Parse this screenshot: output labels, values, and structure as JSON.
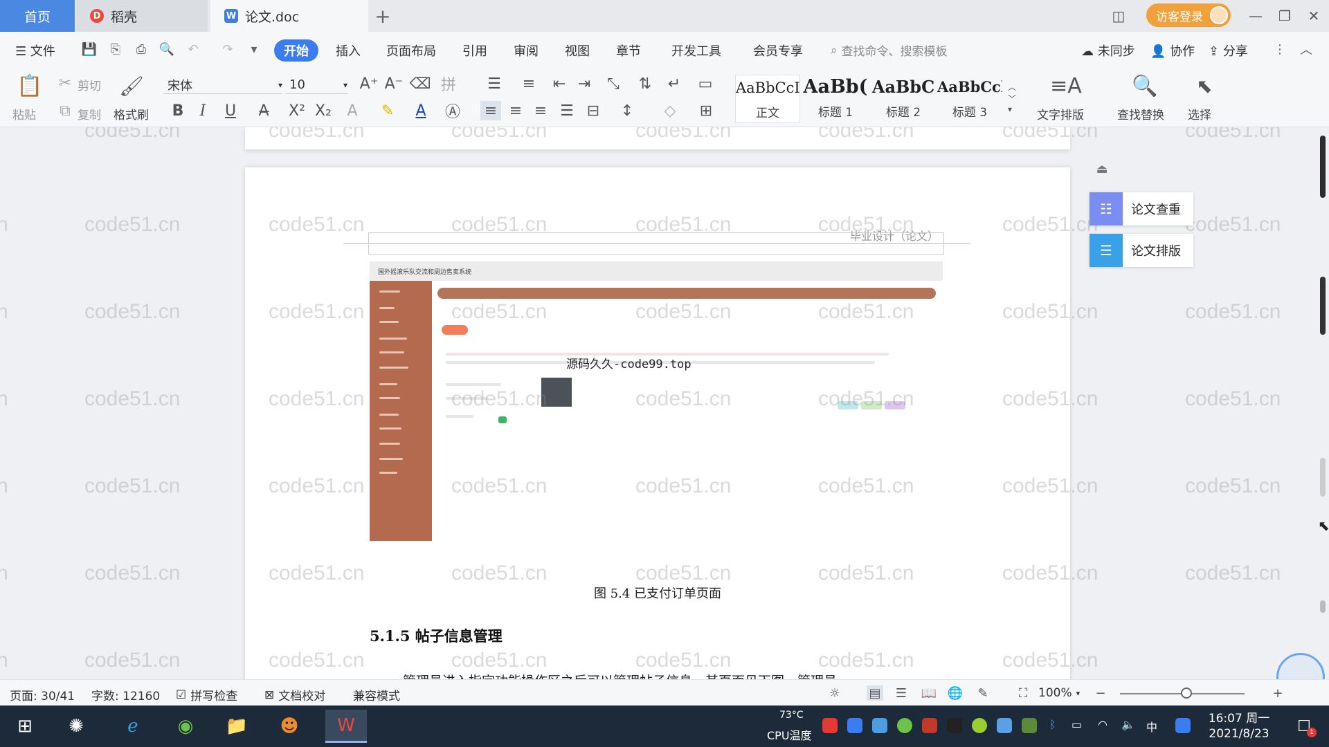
{
  "tabs": {
    "home": "首页",
    "docer": "稻壳",
    "doc": "论文.doc",
    "add": "+",
    "docer_logo": "D",
    "doc_logo": "W"
  },
  "login": {
    "label": "访客登录"
  },
  "menu": {
    "file": "文件",
    "items": [
      "开始",
      "插入",
      "页面布局",
      "引用",
      "审阅",
      "视图",
      "章节",
      "开发工具",
      "会员专享"
    ],
    "search_placeholder": "查找命令、搜索模板",
    "sync": "未同步",
    "collab": "协作",
    "share": "分享"
  },
  "ribbon": {
    "paste": "粘贴",
    "cut": "剪切",
    "copy": "复制",
    "format_painter": "格式刷",
    "font": "宋体",
    "size": "10",
    "styles": [
      {
        "sample": "AaBbCcI",
        "name": "正文"
      },
      {
        "sample": "AaBb(",
        "name": "标题 1"
      },
      {
        "sample": "AaBbC",
        "name": "标题 2"
      },
      {
        "sample": "AaBbCcl",
        "name": "标题 3"
      }
    ],
    "text_layout": "文字排版",
    "find_replace": "查找替换",
    "select": "选择"
  },
  "document": {
    "header": "毕业设计（论文）",
    "screenshot_title": "国外摇滚乐队交流和周边售卖系统",
    "embedded_watermark": "源码久久-code99.top",
    "caption": "图 5.4  已支付订单页面",
    "heading": "5.1.5  帖子信息管理",
    "paragraph": "管理员进入指定功能操作区之后可以管理帖子信息。其页面见下图。管理员"
  },
  "watermark_text": "code51.cn",
  "side_panel": {
    "check": "论文查重",
    "format": "论文排版"
  },
  "status": {
    "page": "页面: 30/41",
    "words": "字数: 12160",
    "spell": "拼写检查",
    "proof": "文档校对",
    "compat": "兼容模式",
    "zoom": "100%"
  },
  "taskbar": {
    "cpu_temp": "73°C",
    "cpu_label": "CPU温度",
    "ime": "中",
    "time": "16:07 周一",
    "date": "2021/8/23",
    "notify_count": "1"
  },
  "colors": {
    "accent": "#3a7df0",
    "login": "#f2a13a",
    "check_icon": "#7b8df0",
    "format_icon": "#3aa1e8"
  }
}
